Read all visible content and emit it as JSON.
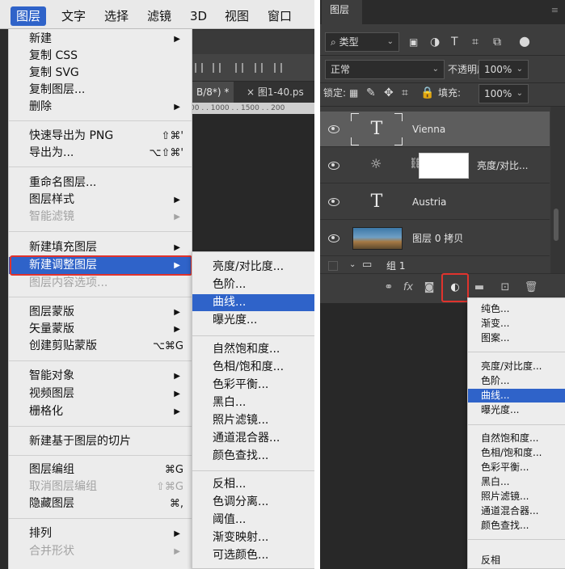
{
  "menubar": {
    "items": [
      "图层",
      "文字",
      "选择",
      "滤镜",
      "3D",
      "视图",
      "窗口"
    ],
    "active_index": 0
  },
  "doc": {
    "tab_active": "B/8*) *",
    "tab_other": "× 图1-40.ps",
    "ruler": "00 . . 1000 . . 1500 . . 200"
  },
  "layer_menu": {
    "items": [
      {
        "label": "新建",
        "shortcut": "",
        "submenu": true,
        "disabled": false
      },
      {
        "label": "复制 CSS",
        "shortcut": "",
        "submenu": false,
        "disabled": false
      },
      {
        "label": "复制 SVG",
        "shortcut": "",
        "submenu": false,
        "disabled": false
      },
      {
        "label": "复制图层...",
        "shortcut": "",
        "submenu": false,
        "disabled": false
      },
      {
        "label": "删除",
        "shortcut": "",
        "submenu": true,
        "disabled": false
      },
      {
        "label": "快速导出为 PNG",
        "shortcut": "⇧⌘'",
        "submenu": false,
        "disabled": false
      },
      {
        "label": "导出为...",
        "shortcut": "⌥⇧⌘'",
        "submenu": false,
        "disabled": false
      },
      {
        "label": "重命名图层...",
        "shortcut": "",
        "submenu": false,
        "disabled": false
      },
      {
        "label": "图层样式",
        "shortcut": "",
        "submenu": true,
        "disabled": false
      },
      {
        "label": "智能滤镜",
        "shortcut": "",
        "submenu": true,
        "disabled": true
      },
      {
        "label": "新建填充图层",
        "shortcut": "",
        "submenu": true,
        "disabled": false
      },
      {
        "label": "新建调整图层",
        "shortcut": "",
        "submenu": true,
        "disabled": false,
        "highlighted": true
      },
      {
        "label": "图层内容选项...",
        "shortcut": "",
        "submenu": false,
        "disabled": true
      },
      {
        "label": "图层蒙版",
        "shortcut": "",
        "submenu": true,
        "disabled": false
      },
      {
        "label": "矢量蒙版",
        "shortcut": "",
        "submenu": true,
        "disabled": false
      },
      {
        "label": "创建剪贴蒙版",
        "shortcut": "⌥⌘G",
        "submenu": false,
        "disabled": false
      },
      {
        "label": "智能对象",
        "shortcut": "",
        "submenu": true,
        "disabled": false
      },
      {
        "label": "视频图层",
        "shortcut": "",
        "submenu": true,
        "disabled": false
      },
      {
        "label": "栅格化",
        "shortcut": "",
        "submenu": true,
        "disabled": false
      },
      {
        "label": "新建基于图层的切片",
        "shortcut": "",
        "submenu": false,
        "disabled": false
      },
      {
        "label": "图层编组",
        "shortcut": "⌘G",
        "submenu": false,
        "disabled": false
      },
      {
        "label": "取消图层编组",
        "shortcut": "⇧⌘G",
        "submenu": false,
        "disabled": true
      },
      {
        "label": "隐藏图层",
        "shortcut": "⌘,",
        "submenu": false,
        "disabled": false
      },
      {
        "label": "排列",
        "shortcut": "",
        "submenu": true,
        "disabled": false
      },
      {
        "label": "合并形状",
        "shortcut": "",
        "submenu": true,
        "disabled": true
      }
    ]
  },
  "adjust_submenu_left": {
    "items": [
      "亮度/对比度...",
      "色阶...",
      "曲线...",
      "曝光度...",
      "自然饱和度...",
      "色相/饱和度...",
      "色彩平衡...",
      "黑白...",
      "照片滤镜...",
      "通道混合器...",
      "颜色查找...",
      "反相...",
      "色调分离...",
      "阈值...",
      "渐变映射...",
      "可选颜色..."
    ],
    "highlighted_index": 2
  },
  "layers_panel": {
    "tab": "图层",
    "filter_label": "类型",
    "blend_mode": "正常",
    "opacity_label": "不透明度:",
    "opacity_value": "100%",
    "lock_label": "锁定:",
    "fill_label": "填充:",
    "fill_value": "100%",
    "layers": [
      {
        "name": "Vienna",
        "kind": "text",
        "selected": true
      },
      {
        "name": "亮度/对比...",
        "kind": "adjustment",
        "selected": false
      },
      {
        "name": "Austria",
        "kind": "text",
        "selected": false
      },
      {
        "name": "图层 0 拷贝",
        "kind": "image",
        "selected": false
      },
      {
        "name": "组 1",
        "kind": "group",
        "selected": false
      }
    ]
  },
  "adjust_submenu_right": {
    "items": [
      "纯色...",
      "渐变...",
      "图案...",
      "亮度/对比度...",
      "色阶...",
      "曲线...",
      "曝光度...",
      "自然饱和度...",
      "色相/饱和度...",
      "色彩平衡...",
      "黑白...",
      "照片滤镜...",
      "通道混合器...",
      "颜色查找...",
      "反相"
    ],
    "highlighted_index": 5
  },
  "colors": {
    "highlight": "#2f63c9",
    "annotation_red": "#e0332d",
    "panel_dark": "#3d3d3d",
    "menu_bg": "#ececec"
  }
}
